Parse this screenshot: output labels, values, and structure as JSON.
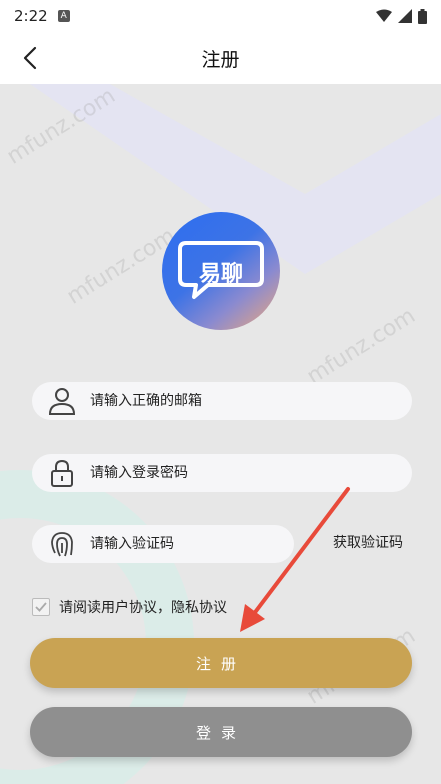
{
  "status_bar": {
    "time": "2:22",
    "badge": "A",
    "icons": [
      "wifi-icon",
      "signal-icon",
      "battery-icon"
    ]
  },
  "nav": {
    "title": "注册",
    "back_icon": "chevron-left-icon"
  },
  "logo": {
    "text": "易聊",
    "icon": "chat-bubble-icon"
  },
  "form": {
    "email_placeholder": "请输入正确的邮箱",
    "password_placeholder": "请输入登录密码",
    "code_placeholder": "请输入验证码",
    "get_code_label": "获取验证码"
  },
  "agreement": {
    "text": "请阅读用户协议，隐私协议",
    "checked": true
  },
  "buttons": {
    "register_label": "注册",
    "login_label": "登录"
  },
  "watermark": "mfunz.com",
  "colors": {
    "register": "#c9a353",
    "login": "#8f8f8f",
    "annotation_arrow": "#e84a3a"
  }
}
